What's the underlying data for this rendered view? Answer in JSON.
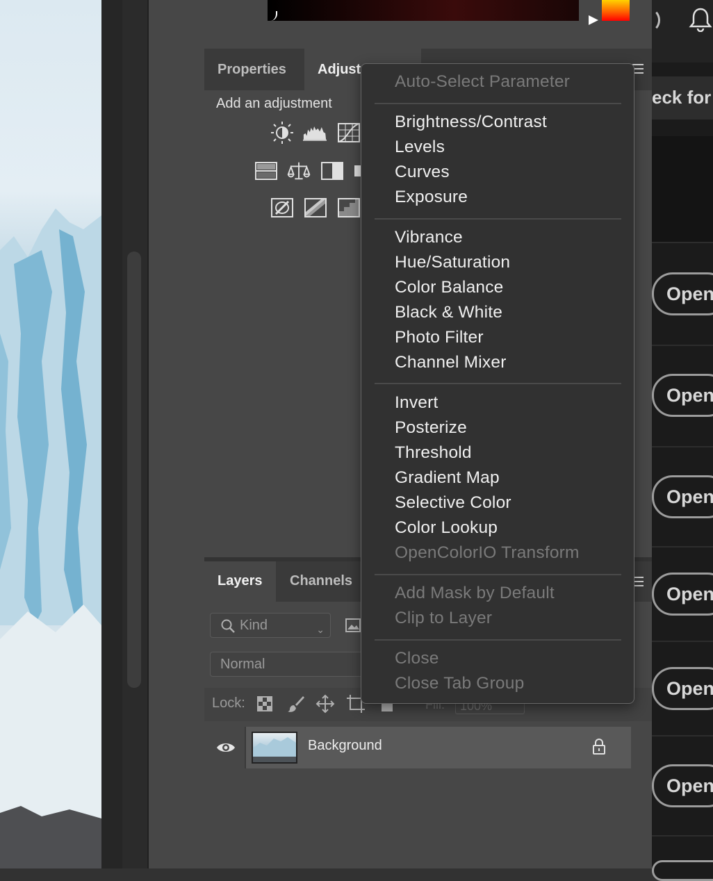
{
  "adjustments_panel": {
    "tabs": [
      "Properties",
      "Adjustments"
    ],
    "heading": "Add an adjustment"
  },
  "layers_panel": {
    "tabs": [
      "Layers",
      "Channels"
    ],
    "kind_filter": "Kind",
    "blend_mode": "Normal",
    "lock_label": "Lock:",
    "fill_label": "Fill:",
    "fill_value": "100%",
    "layer_name": "Background"
  },
  "context_menu": {
    "items": [
      {
        "label": "Auto-Select Parameter",
        "enabled": false
      },
      {
        "label": "Brightness/Contrast",
        "enabled": true
      },
      {
        "label": "Levels",
        "enabled": true
      },
      {
        "label": "Curves",
        "enabled": true
      },
      {
        "label": "Exposure",
        "enabled": true
      },
      {
        "label": "Vibrance",
        "enabled": true
      },
      {
        "label": "Hue/Saturation",
        "enabled": true
      },
      {
        "label": "Color Balance",
        "enabled": true
      },
      {
        "label": "Black & White",
        "enabled": true
      },
      {
        "label": "Photo Filter",
        "enabled": true
      },
      {
        "label": "Channel Mixer",
        "enabled": true
      },
      {
        "label": "Invert",
        "enabled": true
      },
      {
        "label": "Posterize",
        "enabled": true
      },
      {
        "label": "Threshold",
        "enabled": true
      },
      {
        "label": "Gradient Map",
        "enabled": true
      },
      {
        "label": "Selective Color",
        "enabled": true
      },
      {
        "label": "Color Lookup",
        "enabled": true
      },
      {
        "label": "OpenColorIO Transform",
        "enabled": false
      },
      {
        "label": "Add Mask by Default",
        "enabled": false
      },
      {
        "label": "Clip to Layer",
        "enabled": false
      },
      {
        "label": "Close",
        "enabled": false
      },
      {
        "label": "Close Tab Group",
        "enabled": false
      }
    ]
  },
  "right_panel": {
    "banner": "eck for u",
    "open_buttons": [
      "Open",
      "Open",
      "Open",
      "Open",
      "Open",
      "Open"
    ]
  },
  "icons": {
    "adjustment_icons": [
      "brightness-contrast-icon",
      "levels-icon",
      "curves-icon",
      "vibrance-icon",
      "color-balance-icon",
      "black-white-icon",
      "invert-icon",
      "posterize-icon",
      "threshold-icon"
    ],
    "lock_icons": [
      "lock-transparent-pixels-icon",
      "lock-image-pixels-icon",
      "lock-position-icon",
      "lock-artboard-icon",
      "lock-all-icon"
    ]
  },
  "colors": {
    "menu_bg": "#313131",
    "panel_bg": "#474747",
    "disabled_text": "#7a7a7a",
    "enabled_text": "#f0f0f0"
  }
}
